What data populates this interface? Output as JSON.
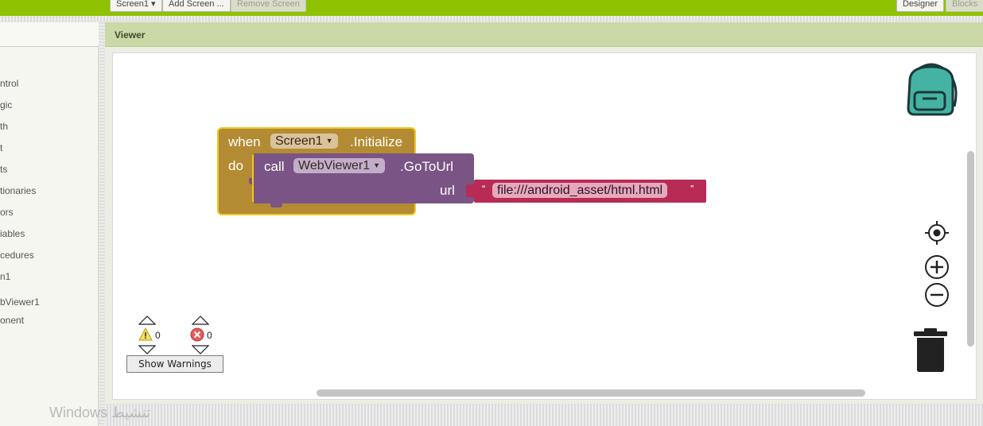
{
  "topbar": {
    "screen_select": "Screen1 ▾",
    "add_screen": "Add Screen ...",
    "remove_screen": "Remove Screen",
    "designer": "Designer",
    "blocks": "Blocks"
  },
  "palette": {
    "items": [
      "ntrol",
      "gic",
      "th",
      "t",
      "ts",
      "tionaries",
      "ors",
      "iables",
      "cedures",
      "n1",
      "bViewer1",
      "onent"
    ]
  },
  "viewer": {
    "title": "Viewer"
  },
  "event_block": {
    "when": "when",
    "component": "Screen1",
    "event": ".Initialize",
    "do": "do"
  },
  "call_block": {
    "call": "call",
    "component": "WebViewer1",
    "method": ".GoToUrl",
    "param": "url"
  },
  "text_block": {
    "open_quote": "“",
    "value": "file:///android_asset/html.html",
    "close_quote": "”"
  },
  "warnings": {
    "warning_count": "0",
    "error_count": "0",
    "show_label": "Show Warnings"
  },
  "watermark": {
    "text": "Windows تنشيط"
  },
  "colors": {
    "topbar": "#8fc202",
    "event": "#b38b33",
    "call": "#7a5485",
    "text": "#b72b55",
    "highlight": "#f5c51f"
  }
}
